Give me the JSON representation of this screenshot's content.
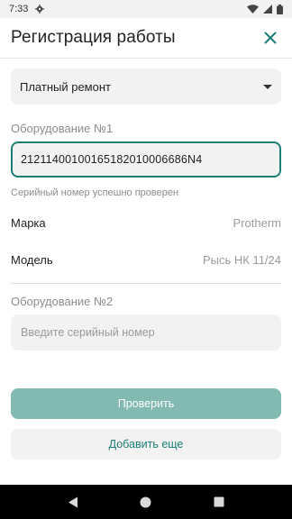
{
  "status_bar": {
    "time": "7:33"
  },
  "header": {
    "title": "Регистрация работы"
  },
  "work_type": {
    "selected": "Платный ремонт"
  },
  "equipment1": {
    "label": "Оборудование №1",
    "serial_value": "21211400100165182010006686N4",
    "helper": "Серийный номер успешно проверен",
    "brand_label": "Марка",
    "brand_value": "Protherm",
    "model_label": "Модель",
    "model_value": "Рысь НК 11/24"
  },
  "equipment2": {
    "label": "Оборудование №2",
    "serial_placeholder": "Введите серийный номер"
  },
  "actions": {
    "check_label": "Проверить",
    "add_more_label": "Добавить еще"
  },
  "colors": {
    "accent": "#1b7f75",
    "disabled_button": "#82b9b2",
    "field_bg": "#f2f2f2"
  }
}
